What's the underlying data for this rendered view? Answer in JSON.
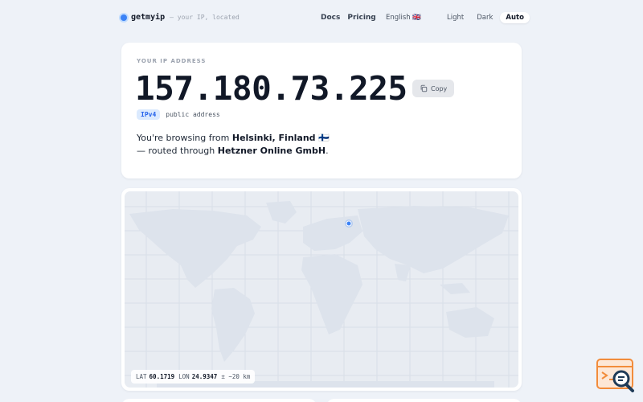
{
  "header": {
    "brand": "getmyip",
    "tagline": "— your IP, located",
    "nav": [
      "Docs",
      "Pricing"
    ],
    "language": "English 🇬🇧",
    "theme_options": [
      "Light",
      "Dark",
      "Auto"
    ],
    "theme_selected": "Auto"
  },
  "ip_card": {
    "label": "YOUR IP ADDRESS",
    "ip": "157.180.73.225",
    "copy_label": "Copy",
    "version_badge": "IPv4",
    "address_type": "public address",
    "sentence_prefix": "You're browsing from ",
    "location": "Helsinki, Finland 🇫🇮",
    "routed_prefix": "— routed through ",
    "isp": "Hetzner Online GmbH",
    "suffix": "."
  },
  "map": {
    "lat_label": "LAT",
    "lat": "60.1719",
    "lon_label": "LON",
    "lon": "24.9347",
    "accuracy": "± ~20 km",
    "marker_color": "#3b82f6"
  },
  "colors": {
    "accent": "#3b82f6",
    "page_bg": "#eef2f8",
    "card_bg": "#ffffff",
    "map_bg": "#e8ecf2",
    "land": "#dde3ec"
  },
  "icons": [
    "status-dot-icon",
    "copy-icon",
    "location-marker-icon",
    "search-widget-icon"
  ]
}
